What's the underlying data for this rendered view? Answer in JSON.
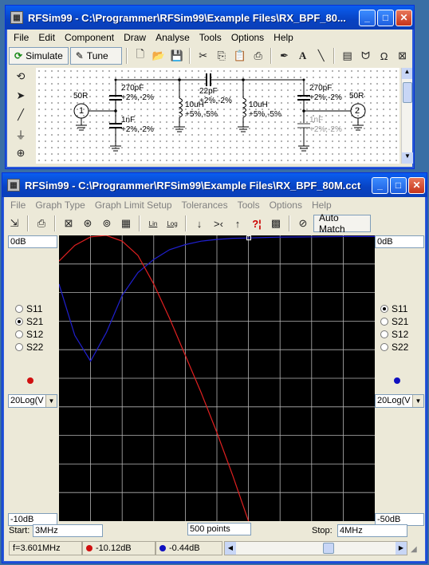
{
  "schematic_window": {
    "title": "RFSim99 - C:\\Programmer\\RFSim99\\Example Files\\RX_BPF_80...",
    "menu": [
      "File",
      "Edit",
      "Component",
      "Draw",
      "Analyse",
      "Tools",
      "Options",
      "Help"
    ],
    "simulate_label": "Simulate",
    "tune_label": "Tune",
    "components": {
      "port1_impedance": "50R",
      "port1_number": "1",
      "port2_impedance": "50R",
      "port2_number": "2",
      "c1_value": "270pF",
      "c1_tol": "+2%,-2%",
      "c2_value": "1nF",
      "c2_tol": "+2%,-2%",
      "l1_value": "10uH",
      "l1_tol": "+5%,-5%",
      "c3_value": "22pF",
      "c3_tol": "+2%,-2%",
      "l2_value": "10uH",
      "l2_tol": "+5%,-5%",
      "c4_value": "270pF",
      "c4_tol": "+2%,-2%",
      "c5_value": "1nF",
      "c5_tol": "+2%,-2%"
    }
  },
  "graph_window": {
    "title": "RFSim99 - C:\\Programmer\\RFSim99\\Example Files\\RX_BPF_80M.cct",
    "menu": [
      "File",
      "Graph Type",
      "Graph Limit Setup",
      "Tolerances",
      "Tools",
      "Options",
      "Help"
    ],
    "auto_match_label": "Auto Match",
    "left_panel": {
      "top_value": "0dB",
      "bottom_value": "-10dB",
      "params": [
        "S11",
        "S21",
        "S12",
        "S22"
      ],
      "selected": "S21",
      "dot_color": "#d01010",
      "scale": "20Log(V"
    },
    "right_panel": {
      "top_value": "0dB",
      "bottom_value": "-50dB",
      "params": [
        "S11",
        "S21",
        "S12",
        "S22"
      ],
      "selected": "S11",
      "dot_color": "#1010c0",
      "scale": "20Log(V"
    },
    "start_label": "Start:",
    "start_value": "3MHz",
    "points_value": "500 points",
    "stop_label": "Stop:",
    "stop_value": "4MHz",
    "status": {
      "freq": "f=3.601MHz",
      "s21_value": "-10.12dB",
      "s11_value": "-0.44dB"
    },
    "colors": {
      "s21_trace": "#e02020",
      "s11_trace": "#2020d0",
      "grid": "#b4b4b4",
      "plot_bg": "#000000"
    }
  },
  "chart_data": {
    "type": "line",
    "title": "",
    "xlabel": "",
    "ylabel": "",
    "xlim": [
      3,
      4
    ],
    "x_unit": "MHz",
    "series": [
      {
        "name": "S21",
        "axis": "left",
        "ylim": [
          -10,
          0
        ],
        "x": [
          3.0,
          3.05,
          3.1,
          3.15,
          3.2,
          3.25,
          3.3,
          3.35,
          3.4,
          3.45,
          3.5,
          3.55,
          3.6,
          3.601
        ],
        "y": [
          -0.9,
          -0.35,
          -0.05,
          0.0,
          -0.2,
          -0.7,
          -1.7,
          -2.9,
          -4.2,
          -5.5,
          -6.9,
          -8.4,
          -10.0,
          -10.12
        ]
      },
      {
        "name": "S11",
        "axis": "right",
        "ylim": [
          -50,
          0
        ],
        "x": [
          3.0,
          3.05,
          3.1,
          3.15,
          3.2,
          3.25,
          3.3,
          3.35,
          3.4,
          3.45,
          3.5,
          3.55,
          3.6,
          3.7,
          3.8,
          3.9,
          4.0
        ],
        "y": [
          -8.5,
          -17.5,
          -22.0,
          -17.0,
          -10.5,
          -6.5,
          -4.2,
          -2.5,
          -1.6,
          -1.0,
          -0.7,
          -0.5,
          -0.44,
          -0.3,
          -0.25,
          -0.2,
          -0.2
        ]
      }
    ],
    "cursor_x": 3.601,
    "grid": true,
    "grid_divisions": {
      "x": 10,
      "y": 10
    }
  }
}
